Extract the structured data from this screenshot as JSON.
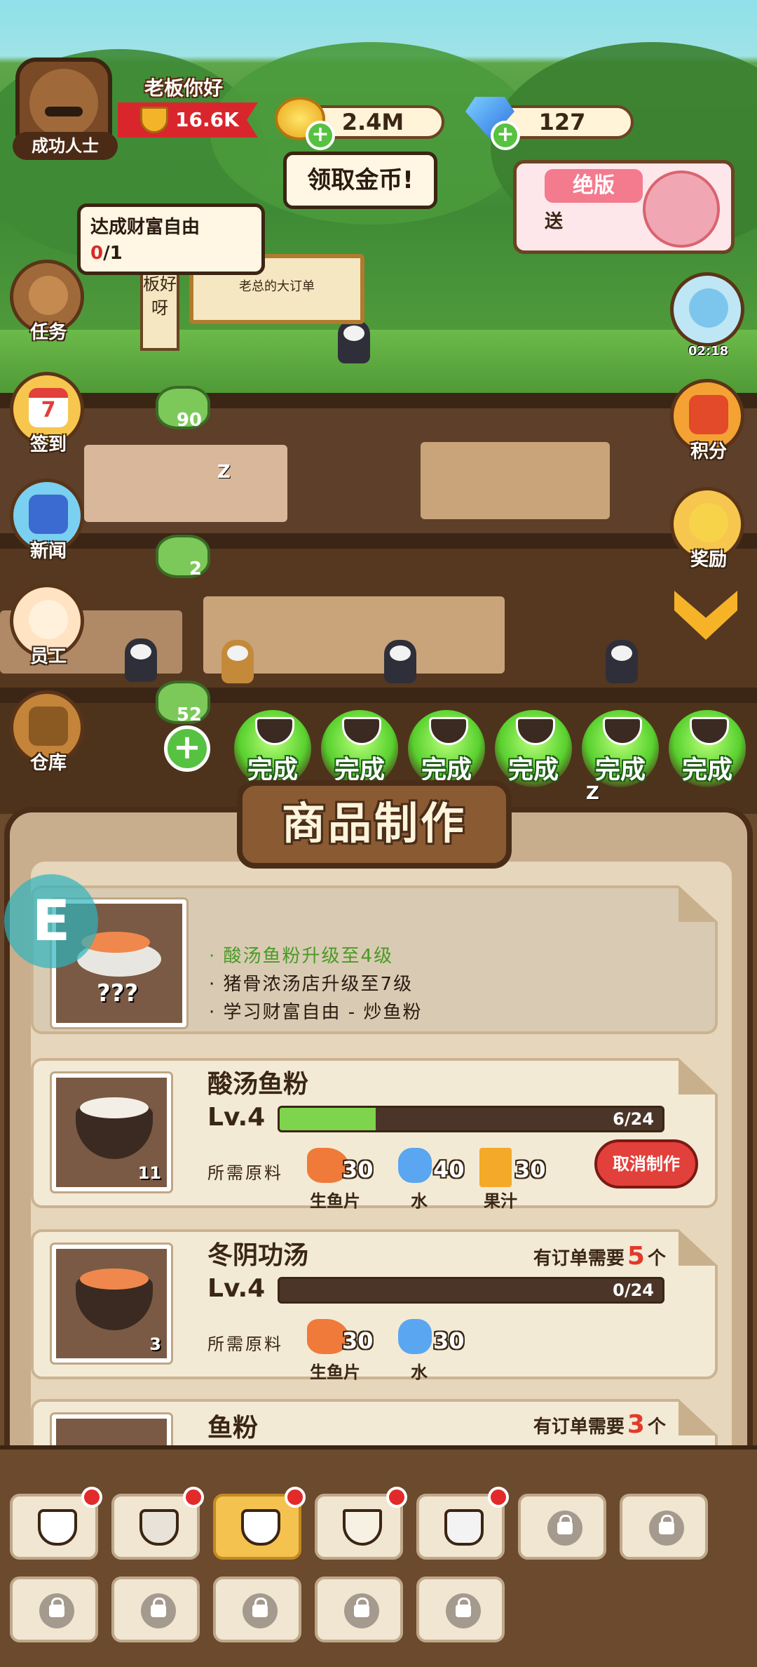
{
  "hud": {
    "avatar_title": "成功人士",
    "greeting": "老板你好",
    "wealth": "16.6K",
    "coins": "2.4M",
    "gems": "127",
    "collect_coins": "领取金币!"
  },
  "promo": {
    "title": "绝版",
    "send": "送"
  },
  "quest": {
    "title": "达成财富自由",
    "progress_current": "0",
    "progress_total": "/1"
  },
  "signs": {
    "vertical": "板好呀",
    "board": "老总的大订单"
  },
  "side_left": [
    {
      "label": "任务"
    },
    {
      "label": "签到",
      "day": "7"
    },
    {
      "label": "新闻"
    },
    {
      "label": "员工"
    },
    {
      "label": "仓库"
    }
  ],
  "side_right": [
    {
      "label": "",
      "timer": "02:18"
    },
    {
      "label": "积分"
    },
    {
      "label": "奖励"
    }
  ],
  "scene_bubbles": [
    "90",
    "2",
    "52"
  ],
  "done_label": "完成",
  "panel": {
    "title": "商品制作",
    "preview_requirements": [
      "· 酸汤鱼粉升级至4级",
      "· 猪骨浓汤店升级至7级",
      "· 学习财富自由 - 炒鱼粉"
    ],
    "preview_unknown": "???",
    "recipes": [
      {
        "name": "酸汤鱼粉",
        "level": "Lv.4",
        "progress": "6/24",
        "progress_fraction": 0.25,
        "qty": "11",
        "ing_label": "所需原料",
        "ingredients": [
          {
            "name": "生鱼片",
            "amount": "30",
            "color": "#f07a3a"
          },
          {
            "name": "水",
            "amount": "40",
            "color": "#5aa6f0"
          },
          {
            "name": "果汁",
            "amount": "30",
            "color": "#f4a928"
          }
        ],
        "action": "取消制作"
      },
      {
        "name": "冬阴功汤",
        "level": "Lv.4",
        "progress": "0/24",
        "progress_fraction": 0,
        "qty": "3",
        "ing_label": "所需原料",
        "order_prefix": "有订单需要",
        "order_count": "5",
        "order_suffix": "个",
        "ingredients": [
          {
            "name": "生鱼片",
            "amount": "30",
            "color": "#f07a3a"
          },
          {
            "name": "水",
            "amount": "30",
            "color": "#5aa6f0"
          }
        ]
      },
      {
        "name": "鱼粉",
        "order_prefix": "有订单需要",
        "order_count": "3",
        "order_suffix": "个"
      }
    ]
  },
  "badge_letter": "E",
  "tabs": [
    {
      "icon": "coffee-cup-icon",
      "active": false,
      "dot": true
    },
    {
      "icon": "sushi-icon",
      "active": false,
      "dot": true
    },
    {
      "icon": "noodle-bowl-icon",
      "active": true,
      "dot": true
    },
    {
      "icon": "cocktail-icon",
      "active": false,
      "dot": true
    },
    {
      "icon": "flask-icon",
      "active": false,
      "dot": true
    },
    {
      "icon": "lock-icon",
      "active": false,
      "dot": false
    },
    {
      "icon": "lock-icon",
      "active": false,
      "dot": false
    },
    {
      "icon": "lock-icon",
      "active": false,
      "dot": false
    },
    {
      "icon": "lock-icon",
      "active": false,
      "dot": false
    },
    {
      "icon": "lock-icon",
      "active": false,
      "dot": false
    },
    {
      "icon": "lock-icon",
      "active": false,
      "dot": false
    },
    {
      "icon": "lock-icon",
      "active": false,
      "dot": false
    }
  ]
}
